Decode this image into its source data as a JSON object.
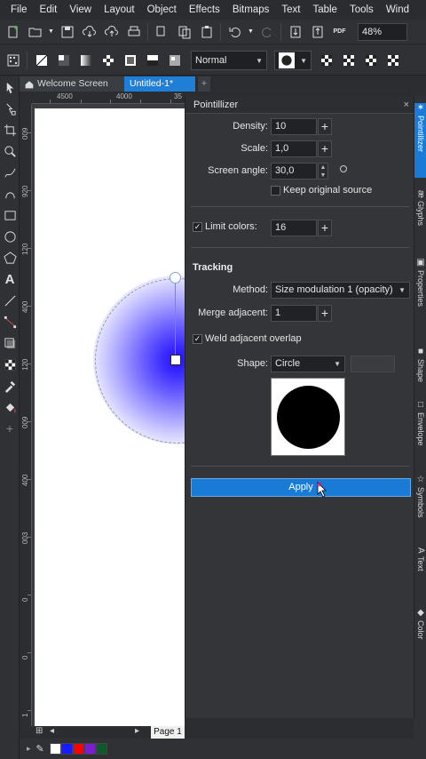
{
  "menu": [
    "File",
    "Edit",
    "View",
    "Layout",
    "Object",
    "Effects",
    "Bitmaps",
    "Text",
    "Table",
    "Tools",
    "Wind"
  ],
  "toolbar": {
    "zoom": "48%",
    "blend_mode": "Normal"
  },
  "tabs": {
    "welcome": "Welcome Screen",
    "document": "Untitled-1*",
    "add": "+"
  },
  "ruler": {
    "h": [
      "4500",
      "4000",
      "35"
    ],
    "v": [
      "009",
      "920",
      "120",
      "400",
      "120",
      "009",
      "400",
      "003",
      "0",
      "0",
      "1"
    ]
  },
  "page_tab": "Page 1",
  "palette_colors": [
    "#ffffff",
    "#1a1aff",
    "#ff0000",
    "#7a1fcf",
    "#0a5a2a"
  ],
  "docker": {
    "title": "Pointillizer",
    "close": "×",
    "density_label": "Density:",
    "density_value": "10",
    "scale_label": "Scale:",
    "scale_value": "1,0",
    "angle_label": "Screen angle:",
    "angle_value": "30,0",
    "keep_original_label": "Keep original source",
    "limit_colors_label": "Limit colors:",
    "limit_colors_value": "16",
    "tracking_title": "Tracking",
    "method_label": "Method:",
    "method_value": "Size modulation 1 (opacity)",
    "merge_label": "Merge adjacent:",
    "merge_value": "1",
    "weld_label": "Weld adjacent overlap",
    "shape_label": "Shape:",
    "shape_value": "Circle",
    "apply_label": "Apply"
  },
  "side_tabs": [
    {
      "icon": "✶",
      "label": "Pointillizer"
    },
    {
      "icon": "æ",
      "label": "Glyphs"
    },
    {
      "icon": "▣",
      "label": "Properties"
    },
    {
      "icon": "■",
      "label": "Shape"
    },
    {
      "icon": "□",
      "label": "Envelope"
    },
    {
      "icon": "☆",
      "label": "Symbols"
    },
    {
      "icon": "A",
      "label": "Text"
    },
    {
      "icon": "◆",
      "label": "Color"
    }
  ]
}
